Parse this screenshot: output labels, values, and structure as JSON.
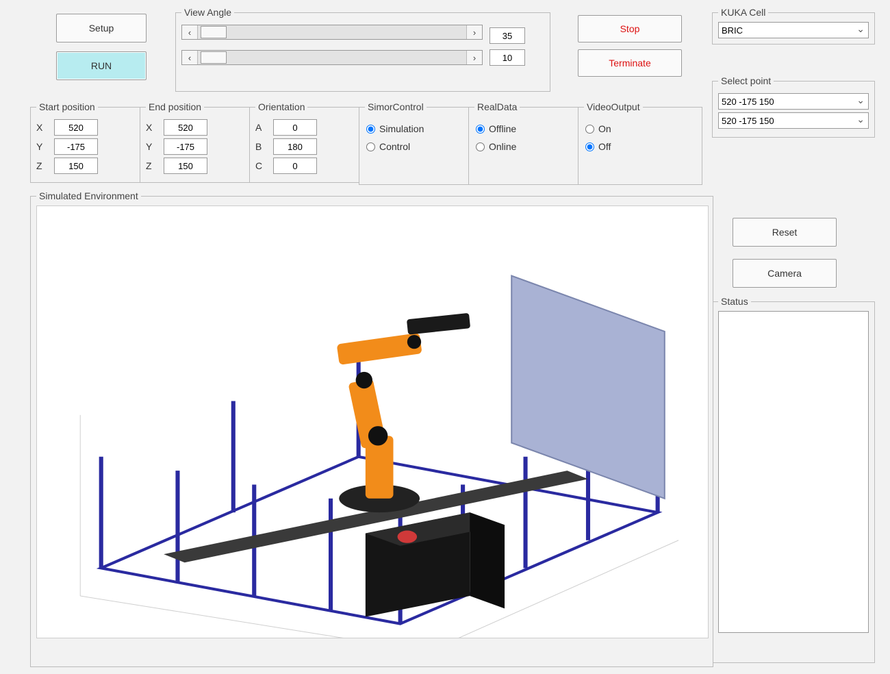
{
  "buttons": {
    "setup": "Setup",
    "run": "RUN",
    "stop": "Stop",
    "terminate": "Terminate",
    "reset": "Reset",
    "camera": "Camera"
  },
  "view_angle": {
    "group_label": "View Angle",
    "value1": "35",
    "value2": "10",
    "scroll_left": "‹",
    "scroll_right": "›"
  },
  "start_position": {
    "group_label": "Start position",
    "x_label": "X",
    "x": "520",
    "y_label": "Y",
    "y": "-175",
    "z_label": "Z",
    "z": "150"
  },
  "end_position": {
    "group_label": "End position",
    "x_label": "X",
    "x": "520",
    "y_label": "Y",
    "y": "-175",
    "z_label": "Z",
    "z": "150"
  },
  "orientation": {
    "group_label": "Orientation",
    "a_label": "A",
    "a": "0",
    "b_label": "B",
    "b": "180",
    "c_label": "C",
    "c": "0"
  },
  "sim_or_control": {
    "group_label": "SimorControl",
    "opt1": "Simulation",
    "opt2": "Control",
    "selected": "Simulation"
  },
  "real_data": {
    "group_label": "RealData",
    "opt1": "Offline",
    "opt2": "Online",
    "selected": "Offline"
  },
  "video_output": {
    "group_label": "VideoOutput",
    "opt1": "On",
    "opt2": "Off",
    "selected": "Off"
  },
  "kuka_cell": {
    "group_label": "KUKA Cell",
    "selected": "BRIC"
  },
  "select_point": {
    "group_label": "Select point",
    "sel1": "520 -175 150",
    "sel2": "520 -175 150"
  },
  "status": {
    "group_label": "Status",
    "text": ""
  },
  "sim_env": {
    "group_label": "Simulated Environment"
  }
}
